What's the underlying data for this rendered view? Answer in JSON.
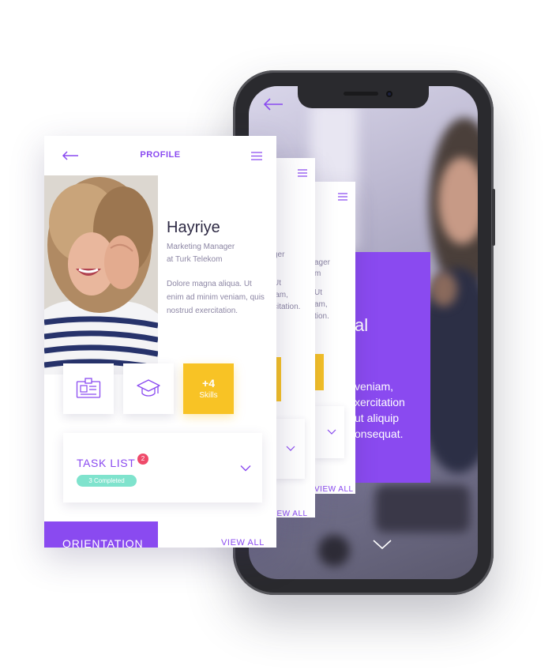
{
  "colors": {
    "accent": "#8a4af0",
    "yellow": "#f8c325",
    "badge": "#ef4a6a",
    "pill": "#7fe3cd"
  },
  "phone": {
    "screen_text_big": "al",
    "screen_paragraph": [
      "veniam,",
      "xercitation",
      "ut aliquip",
      "onsequat."
    ],
    "icons": [
      "back-arrow-icon",
      "chevron-down-icon"
    ]
  },
  "card3": {
    "role_fragment": [
      "ager",
      "m"
    ],
    "desc_fragment": [
      "Ut",
      "am,",
      "tion."
    ],
    "view_all": "VIEW ALL"
  },
  "card2": {
    "role_fragment": "ger",
    "desc_fragment": [
      "Ut",
      "iam,",
      "citation."
    ],
    "view_all": "VIEW ALL"
  },
  "profile": {
    "header": {
      "title": "PROFILE",
      "icons": [
        "back-arrow-icon",
        "hamburger-menu-icon"
      ]
    },
    "name": "Hayriye",
    "role_line1": "Marketing Manager",
    "role_line2": "at Turk Telekom",
    "description": "Dolore magna aliqua. Ut enim ad minim veniam, quis nostrud exercitation.",
    "tiles": {
      "icons": [
        "id-card-icon",
        "graduation-cap-icon"
      ],
      "skills_count": "+4",
      "skills_label": "Skills"
    },
    "task_list": {
      "title": "TASK LIST",
      "badge": "2",
      "completed": "3 Completed"
    },
    "orientation": "ORIENTATION",
    "view_all": "VIEW ALL"
  }
}
